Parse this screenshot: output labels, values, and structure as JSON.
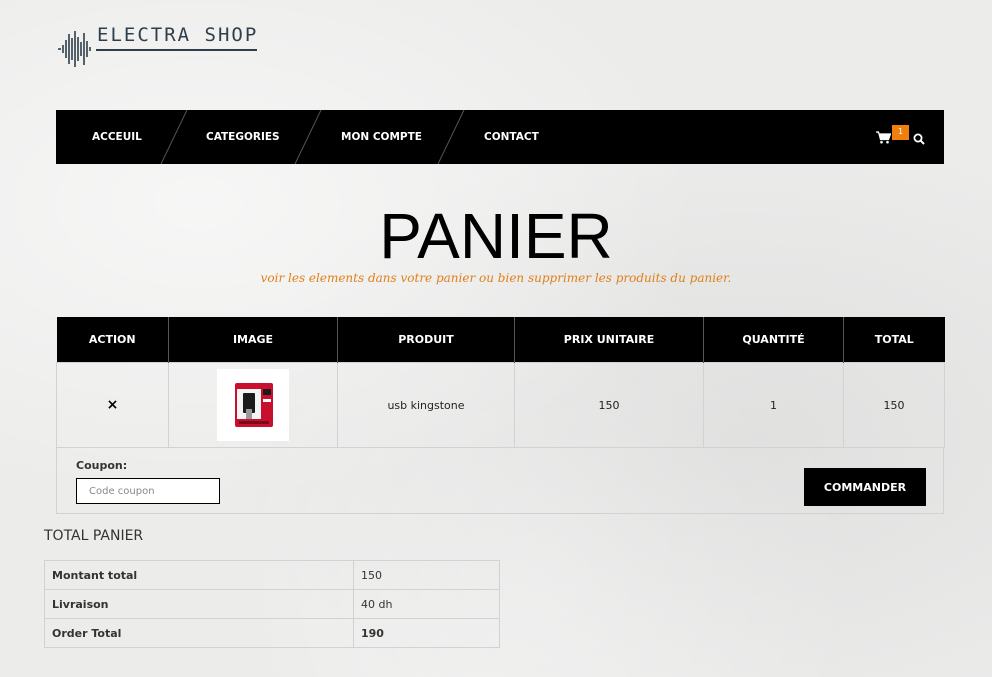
{
  "brand": {
    "name": "ELECTRA SHOP"
  },
  "nav": {
    "items": [
      {
        "label": "ACCEUIL"
      },
      {
        "label": "CATEGORIES"
      },
      {
        "label": "MON COMPTE"
      },
      {
        "label": "CONTACT"
      }
    ],
    "cart_count": "1",
    "cart_icon": "cart-icon",
    "search_icon": "search-icon"
  },
  "page": {
    "title": "PANIER",
    "subtitle": "voir les elements dans votre panier ou bien supprimer les produits du panier."
  },
  "cart": {
    "headers": [
      "ACTION",
      "IMAGE",
      "PRODUIT",
      "PRIX UNITAIRE",
      "QUANTITÉ",
      "TOTAL"
    ],
    "rows": [
      {
        "remove": "×",
        "product": "usb kingstone",
        "unit_price": "150",
        "quantity": "1",
        "total": "150"
      }
    ]
  },
  "coupon": {
    "label": "Coupon:",
    "placeholder": "Code coupon",
    "value": ""
  },
  "order_button": "COMMANDER",
  "totals": {
    "title": "TOTAL PANIER",
    "rows": [
      {
        "label": "Montant total",
        "value": "150"
      },
      {
        "label": "Livraison",
        "value": "40 dh"
      },
      {
        "label": "Order Total",
        "value": "190"
      }
    ]
  },
  "colors": {
    "accent": "#f07f0e",
    "nav_bg": "#000000",
    "subtitle": "#e0801a"
  }
}
